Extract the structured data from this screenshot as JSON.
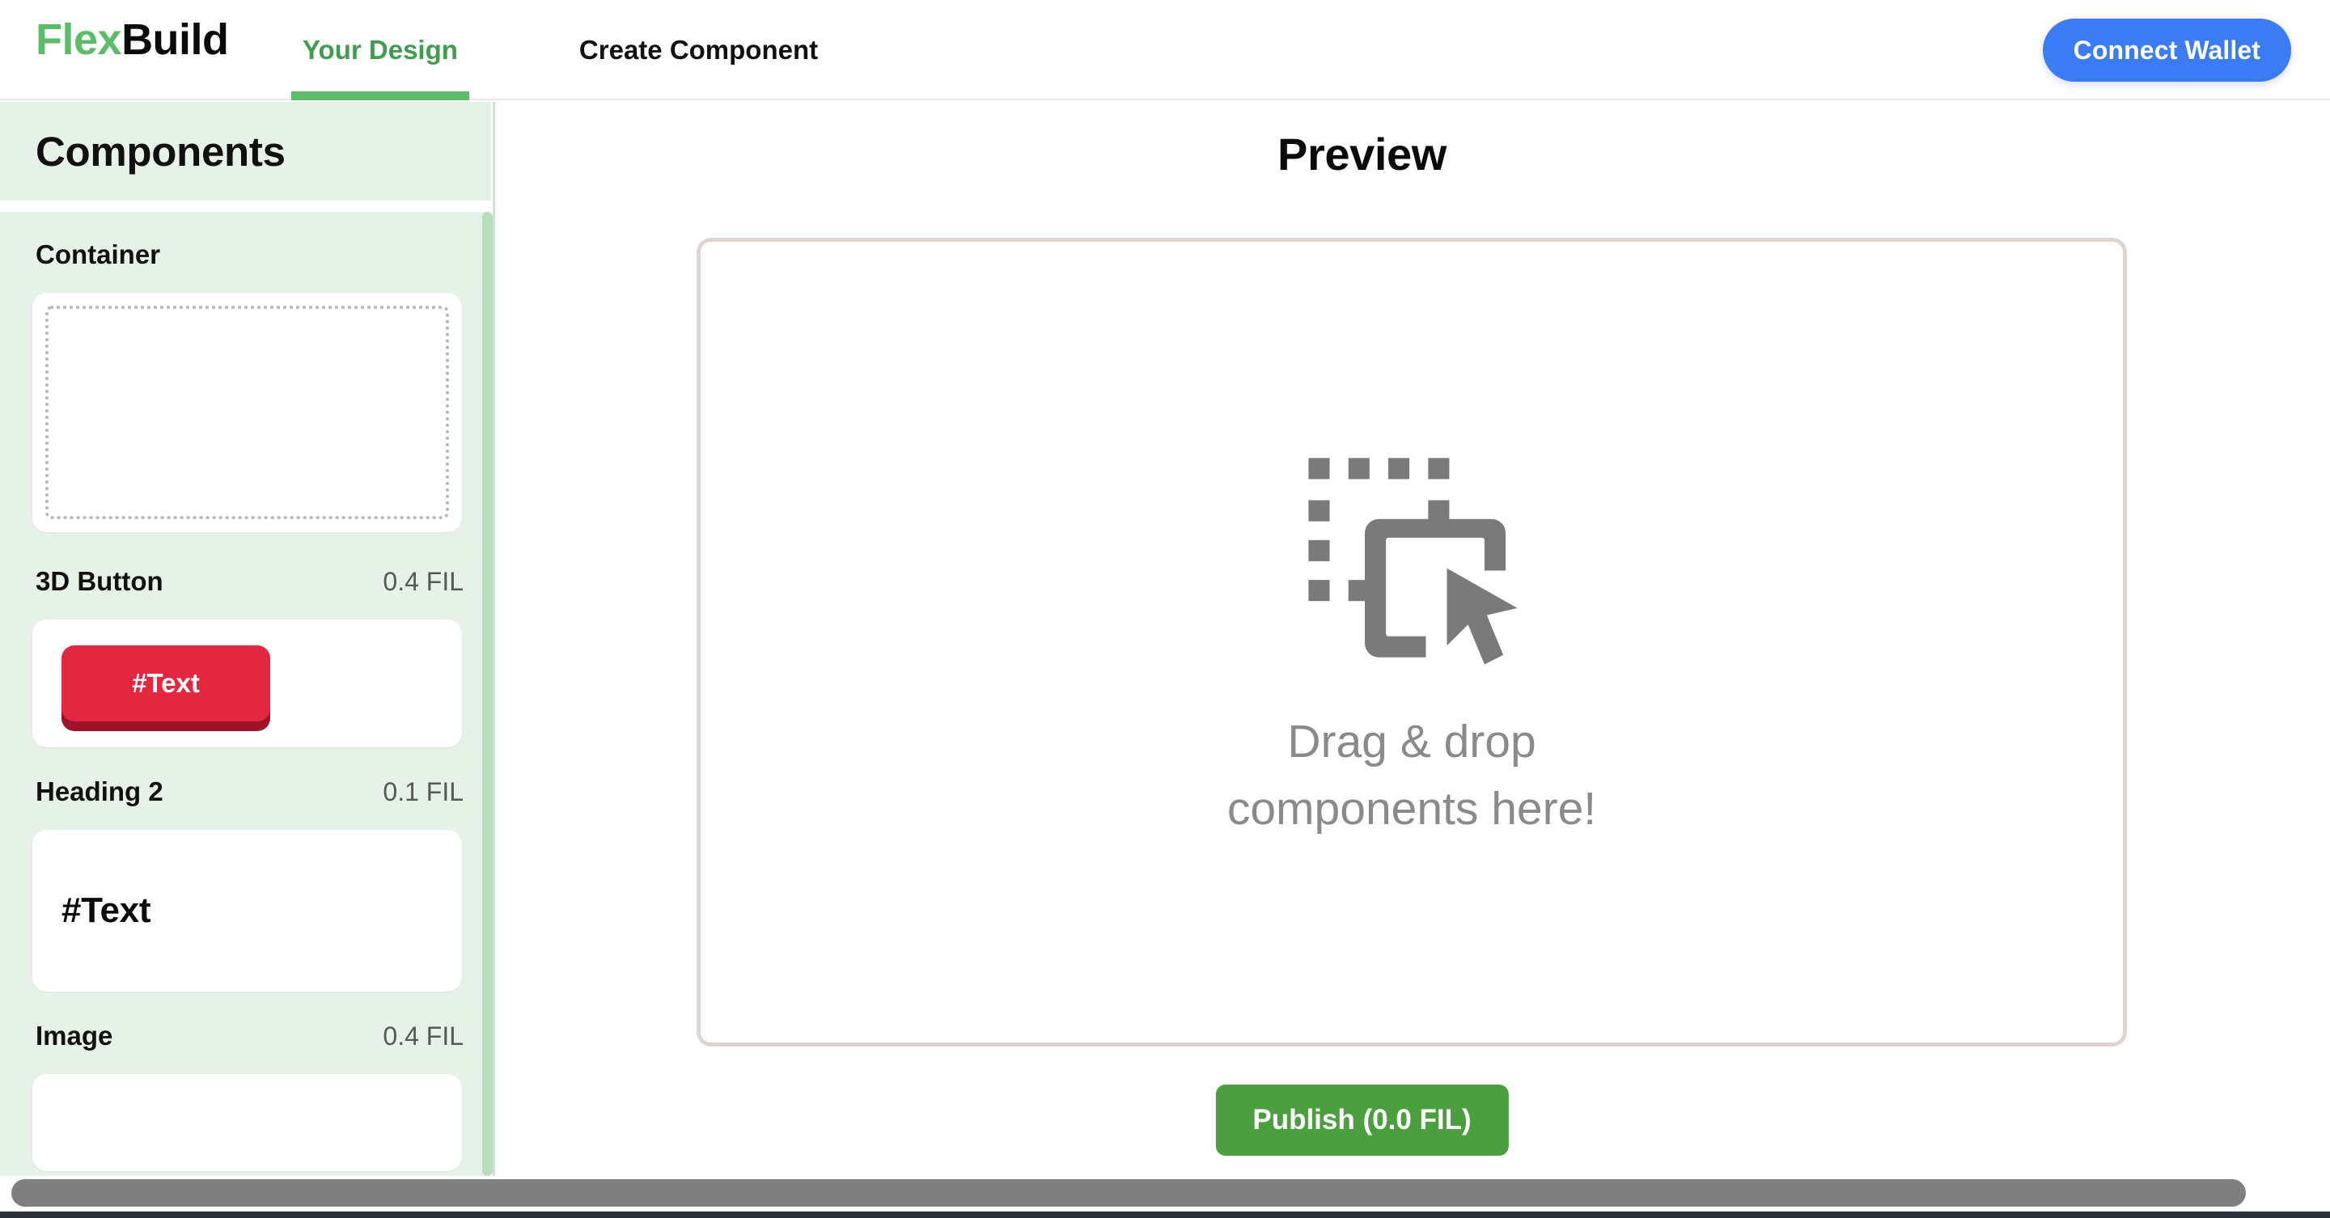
{
  "header": {
    "brand_prefix": "Flex",
    "brand_suffix": "Build",
    "tabs": [
      {
        "label": "Your Design",
        "active": true
      },
      {
        "label": "Create Component",
        "active": false
      }
    ],
    "wallet_button": "Connect Wallet"
  },
  "sidebar": {
    "title": "Components",
    "items": [
      {
        "name": "Container",
        "price": "",
        "preview_kind": "dashed-box",
        "preview_text": ""
      },
      {
        "name": "3D Button",
        "price": "0.4 FIL",
        "preview_kind": "button-3d",
        "preview_text": "#Text"
      },
      {
        "name": "Heading 2",
        "price": "0.1 FIL",
        "preview_kind": "heading",
        "preview_text": "#Text"
      },
      {
        "name": "Image",
        "price": "0.4 FIL",
        "preview_kind": "image",
        "preview_text": ""
      }
    ]
  },
  "main": {
    "preview_title": "Preview",
    "dropzone": {
      "icon": "drag-drop-icon",
      "line1": "Drag & drop",
      "line2": "components here!"
    },
    "publish_button": "Publish (0.0 FIL)"
  },
  "colors": {
    "brand_green": "#5cbc6a",
    "accent_blue": "#3b7cf5",
    "publish_green": "#4c9f3f",
    "sidebar_bg": "#e6f1e7",
    "button_red": "#e32741",
    "button_red_shadow": "#a01228",
    "dropzone_border": "#ded5d3",
    "muted_text": "#8a8a8a"
  }
}
